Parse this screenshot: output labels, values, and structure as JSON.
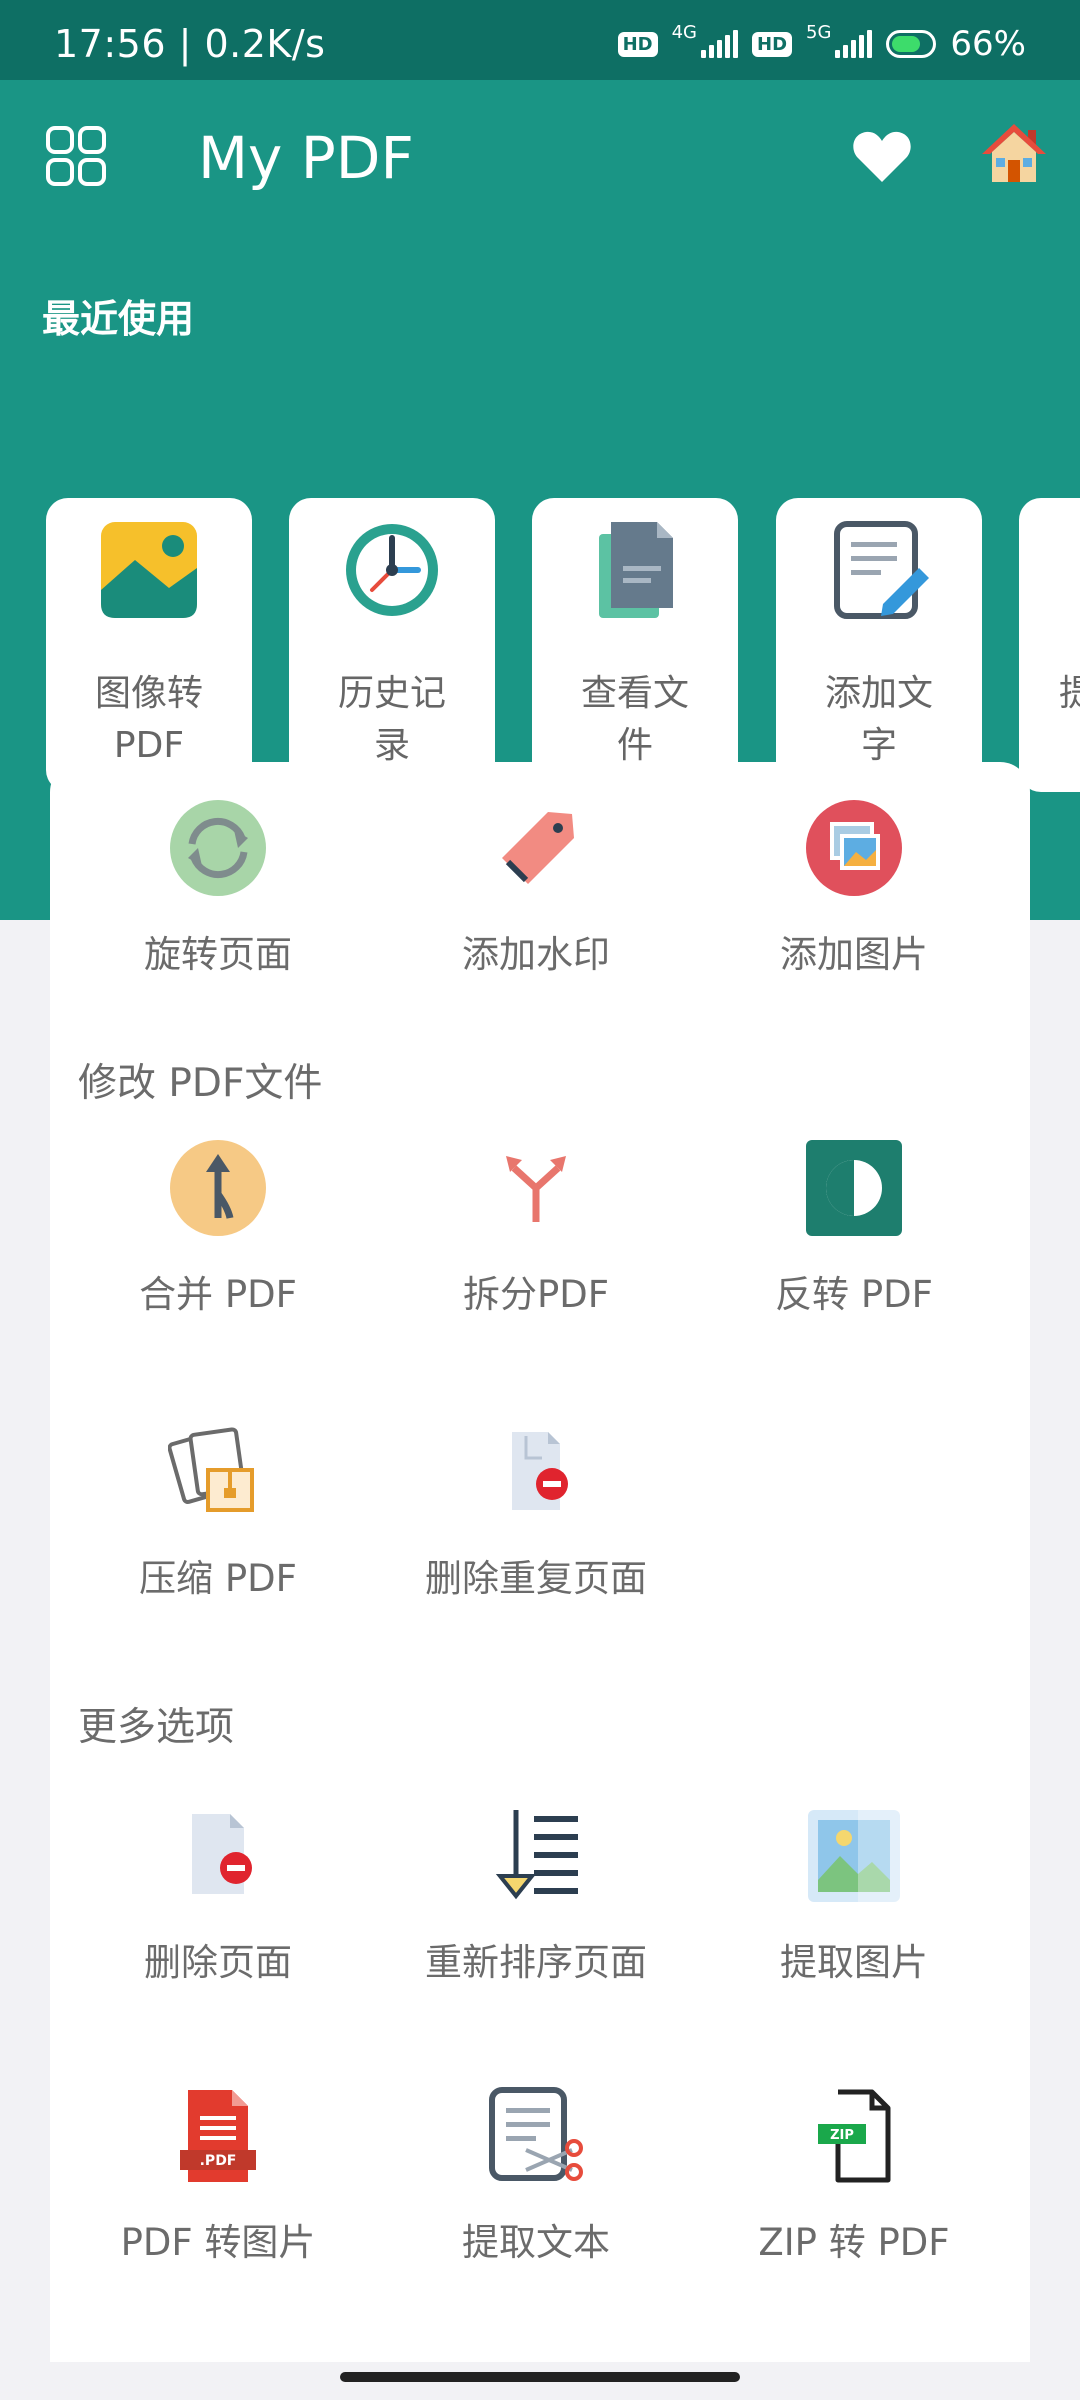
{
  "status_bar": {
    "time": "17:56 | 0.2K/s",
    "net_1": "4G",
    "net_2": "5G",
    "hd": "HD",
    "battery": "66%"
  },
  "header": {
    "title": "My PDF",
    "recent_title": "最近使用"
  },
  "recent": [
    {
      "line1": "图像转",
      "line2": "PDF"
    },
    {
      "line1": "历史记",
      "line2": "录"
    },
    {
      "line1": "查看文",
      "line2": "件"
    },
    {
      "line1": "添加文",
      "line2": "字"
    },
    {
      "line1": "提",
      "line2": ""
    }
  ],
  "tools_top": [
    {
      "label": "旋转页面"
    },
    {
      "label": "添加水印"
    },
    {
      "label": "添加图片"
    }
  ],
  "section_modify": {
    "title": "修改 PDF文件",
    "tools": [
      {
        "label": "合并 PDF"
      },
      {
        "label": "拆分PDF"
      },
      {
        "label": "反转 PDF"
      },
      {
        "label": "压缩 PDF"
      },
      {
        "label": "删除重复页面"
      }
    ]
  },
  "section_more": {
    "title": "更多选项",
    "tools": [
      {
        "label": "删除页面"
      },
      {
        "label": "重新排序页面"
      },
      {
        "label": "提取图片"
      },
      {
        "label": "PDF 转图片"
      },
      {
        "label": "提取文本"
      },
      {
        "label": "ZIP 转 PDF"
      }
    ]
  },
  "icon_text": {
    "pdf_badge": ".PDF",
    "zip_badge": "ZIP"
  }
}
